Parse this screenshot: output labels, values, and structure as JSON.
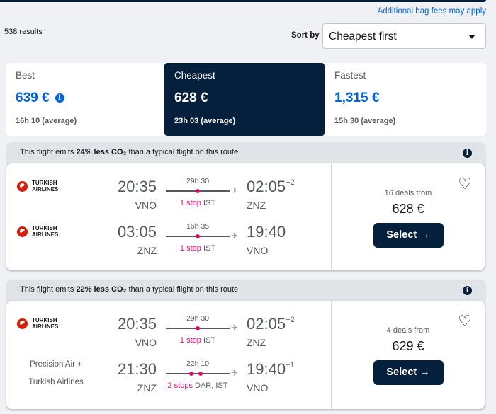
{
  "header": {
    "bag_fees": "Additional bag fees may apply",
    "results": "538 results",
    "sort_label": "Sort by",
    "sort_value": "Cheapest first"
  },
  "tabs": [
    {
      "label": "Best",
      "price": "639 €",
      "duration": "16h 10 (average)",
      "active": false
    },
    {
      "label": "Cheapest",
      "price": "628 €",
      "duration": "23h 03 (average)",
      "active": true
    },
    {
      "label": "Fastest",
      "price": "1,315 €",
      "duration": "15h 30 (average)",
      "active": false
    }
  ],
  "colors": {
    "accent": "#0062e3",
    "dark": "#05203c",
    "stop": "#e70866"
  },
  "flights": [
    {
      "co2_pre": "This flight emits ",
      "co2_bold": "24% less CO₂",
      "co2_post": " than a typical flight on this route",
      "legs": [
        {
          "airline": "TURKISH AIRLINES",
          "airline_l1": "TURKISH",
          "airline_l2": "AIRLINES",
          "dep": "20:35",
          "dep_code": "VNO",
          "duration": "29h 30",
          "stops": "1 stop",
          "via": "IST",
          "arr": "02:05",
          "arr_offset": "+2",
          "arr_code": "ZNZ"
        },
        {
          "airline": "TURKISH AIRLINES",
          "airline_l1": "TURKISH",
          "airline_l2": "AIRLINES",
          "dep": "03:05",
          "dep_code": "ZNZ",
          "duration": "16h 35",
          "stops": "1 stop",
          "via": "IST",
          "arr": "19:40",
          "arr_offset": "",
          "arr_code": "VNO"
        }
      ],
      "deals": "16 deals from",
      "price": "628 €",
      "select": "Select →"
    },
    {
      "co2_pre": "This flight emits ",
      "co2_bold": "22% less CO₂",
      "co2_post": " than a typical flight on this route",
      "legs": [
        {
          "airline": "TURKISH AIRLINES",
          "airline_l1": "TURKISH",
          "airline_l2": "AIRLINES",
          "dep": "20:35",
          "dep_code": "VNO",
          "duration": "29h 30",
          "stops": "1 stop",
          "via": "IST",
          "arr": "02:05",
          "arr_offset": "+2",
          "arr_code": "ZNZ"
        },
        {
          "airline_l1": "Precision Air +",
          "airline_l2": "Turkish Airlines",
          "dep": "21:30",
          "dep_code": "ZNZ",
          "duration": "22h 10",
          "stops": "2 stops",
          "via": "DAR, IST",
          "arr": "19:40",
          "arr_offset": "+1",
          "arr_code": "VNO"
        }
      ],
      "deals": "4 deals from",
      "price": "629 €",
      "select": "Select →"
    }
  ]
}
